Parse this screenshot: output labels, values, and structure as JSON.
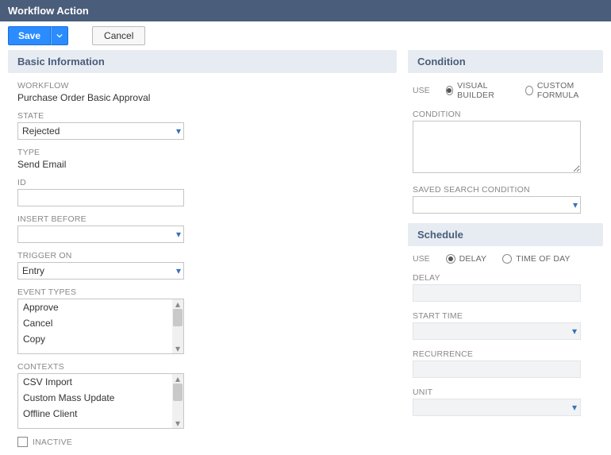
{
  "header": {
    "title": "Workflow Action"
  },
  "toolbar": {
    "save_label": "Save",
    "cancel_label": "Cancel"
  },
  "basic": {
    "section_title": "Basic Information",
    "workflow_label": "WORKFLOW",
    "workflow_value": "Purchase Order Basic Approval",
    "state_label": "STATE",
    "state_value": "Rejected",
    "type_label": "TYPE",
    "type_value": "Send Email",
    "id_label": "ID",
    "id_value": "",
    "insert_before_label": "INSERT BEFORE",
    "insert_before_value": "",
    "trigger_on_label": "TRIGGER ON",
    "trigger_on_value": "Entry",
    "event_types_label": "EVENT TYPES",
    "event_types_options": [
      "Approve",
      "Cancel",
      "Copy"
    ],
    "contexts_label": "CONTEXTS",
    "contexts_options": [
      "CSV Import",
      "Custom Mass Update",
      "Offline Client"
    ],
    "inactive_label": "INACTIVE",
    "inactive_checked": false
  },
  "condition": {
    "section_title": "Condition",
    "use_label": "USE",
    "use_options": [
      "VISUAL BUILDER",
      "CUSTOM FORMULA"
    ],
    "use_selected": "VISUAL BUILDER",
    "condition_label": "CONDITION",
    "condition_value": "",
    "saved_search_label": "SAVED SEARCH CONDITION",
    "saved_search_value": ""
  },
  "schedule": {
    "section_title": "Schedule",
    "use_label": "USE",
    "use_options": [
      "DELAY",
      "TIME OF DAY"
    ],
    "use_selected": "DELAY",
    "delay_label": "DELAY",
    "delay_value": "",
    "start_time_label": "START TIME",
    "start_time_value": "",
    "recurrence_label": "RECURRENCE",
    "recurrence_value": "",
    "unit_label": "UNIT",
    "unit_value": ""
  }
}
